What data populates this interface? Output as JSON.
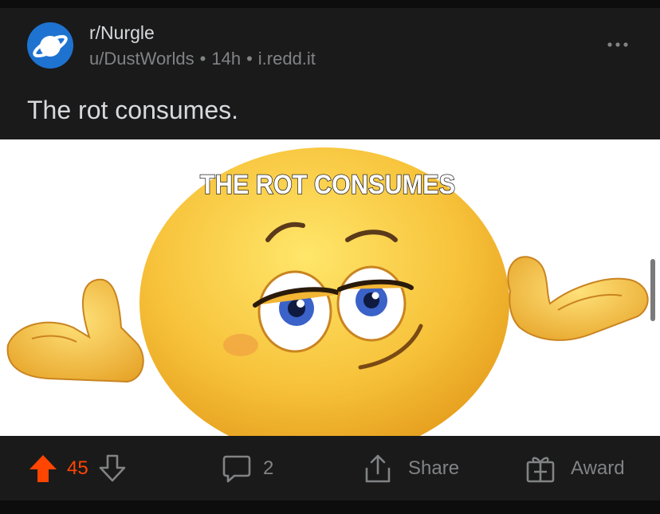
{
  "post": {
    "subreddit": "r/Nurgle",
    "author": "u/DustWorlds",
    "age": "14h",
    "domain": "i.redd.it",
    "title": "The rot consumes.",
    "image": {
      "caption": "THE ROT CONSUMES",
      "subject": "shrugging smug emoji"
    }
  },
  "actions": {
    "score": "45",
    "comments": "2",
    "share_label": "Share",
    "award_label": "Award"
  },
  "icons": {
    "avatar": "planet-icon",
    "more": "more-dots-icon",
    "upvote": "upvote-arrow-icon",
    "downvote": "downvote-arrow-icon",
    "comment": "comment-bubble-icon",
    "share": "share-icon",
    "award": "gift-icon"
  },
  "colors": {
    "background": "#0d0d0e",
    "card": "#1a1a1b",
    "text_primary": "#d7dadc",
    "text_secondary": "#818384",
    "upvote_active": "#ff4500",
    "avatar_blue": "#1e73d1"
  }
}
